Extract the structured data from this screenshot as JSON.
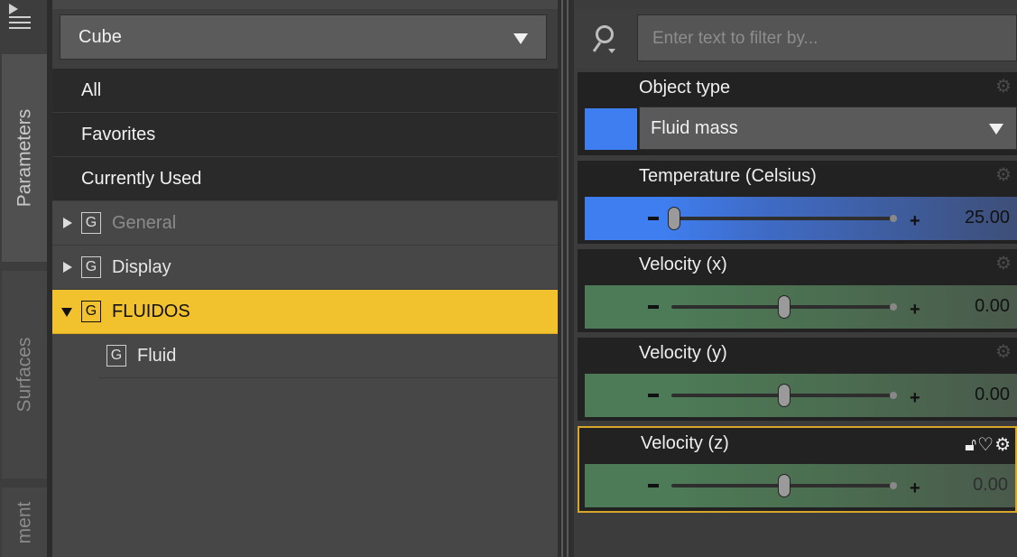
{
  "tabs": [
    {
      "label": "Parameters",
      "active": true
    },
    {
      "label": "Surfaces",
      "active": false
    },
    {
      "label": "ment",
      "active": false
    }
  ],
  "scene": {
    "selected_node": "Cube"
  },
  "tree": {
    "filters": [
      "All",
      "Favorites",
      "Currently Used"
    ],
    "groups": [
      {
        "badge": "G",
        "label": "General",
        "expanded": false,
        "dimmed": true
      },
      {
        "badge": "G",
        "label": "Display",
        "expanded": false
      },
      {
        "badge": "G",
        "label": "FLUIDOS",
        "expanded": true,
        "selected": true
      },
      {
        "badge": "G",
        "label": "Fluid",
        "child": true
      }
    ]
  },
  "search": {
    "placeholder": "Enter text to filter by..."
  },
  "properties": {
    "object_type": {
      "label": "Object type",
      "value": "Fluid mass",
      "swatch_color": "#3f7ef0"
    },
    "temperature": {
      "label": "Temperature (Celsius)",
      "value": "25.00",
      "minus": "-",
      "plus": "+"
    },
    "velocity_x": {
      "label": "Velocity (x)",
      "value": "0.00",
      "minus": "-",
      "plus": "+"
    },
    "velocity_y": {
      "label": "Velocity (y)",
      "value": "0.00",
      "minus": "-",
      "plus": "+"
    },
    "velocity_z": {
      "label": "Velocity (z)",
      "value": "0.00",
      "minus": "-",
      "plus": "+"
    }
  },
  "colors": {
    "selection": "#f2c12e",
    "accent_blue": "#3f7ef0",
    "slider_green": "#4d7a57",
    "focus_border": "#d8a72a"
  }
}
